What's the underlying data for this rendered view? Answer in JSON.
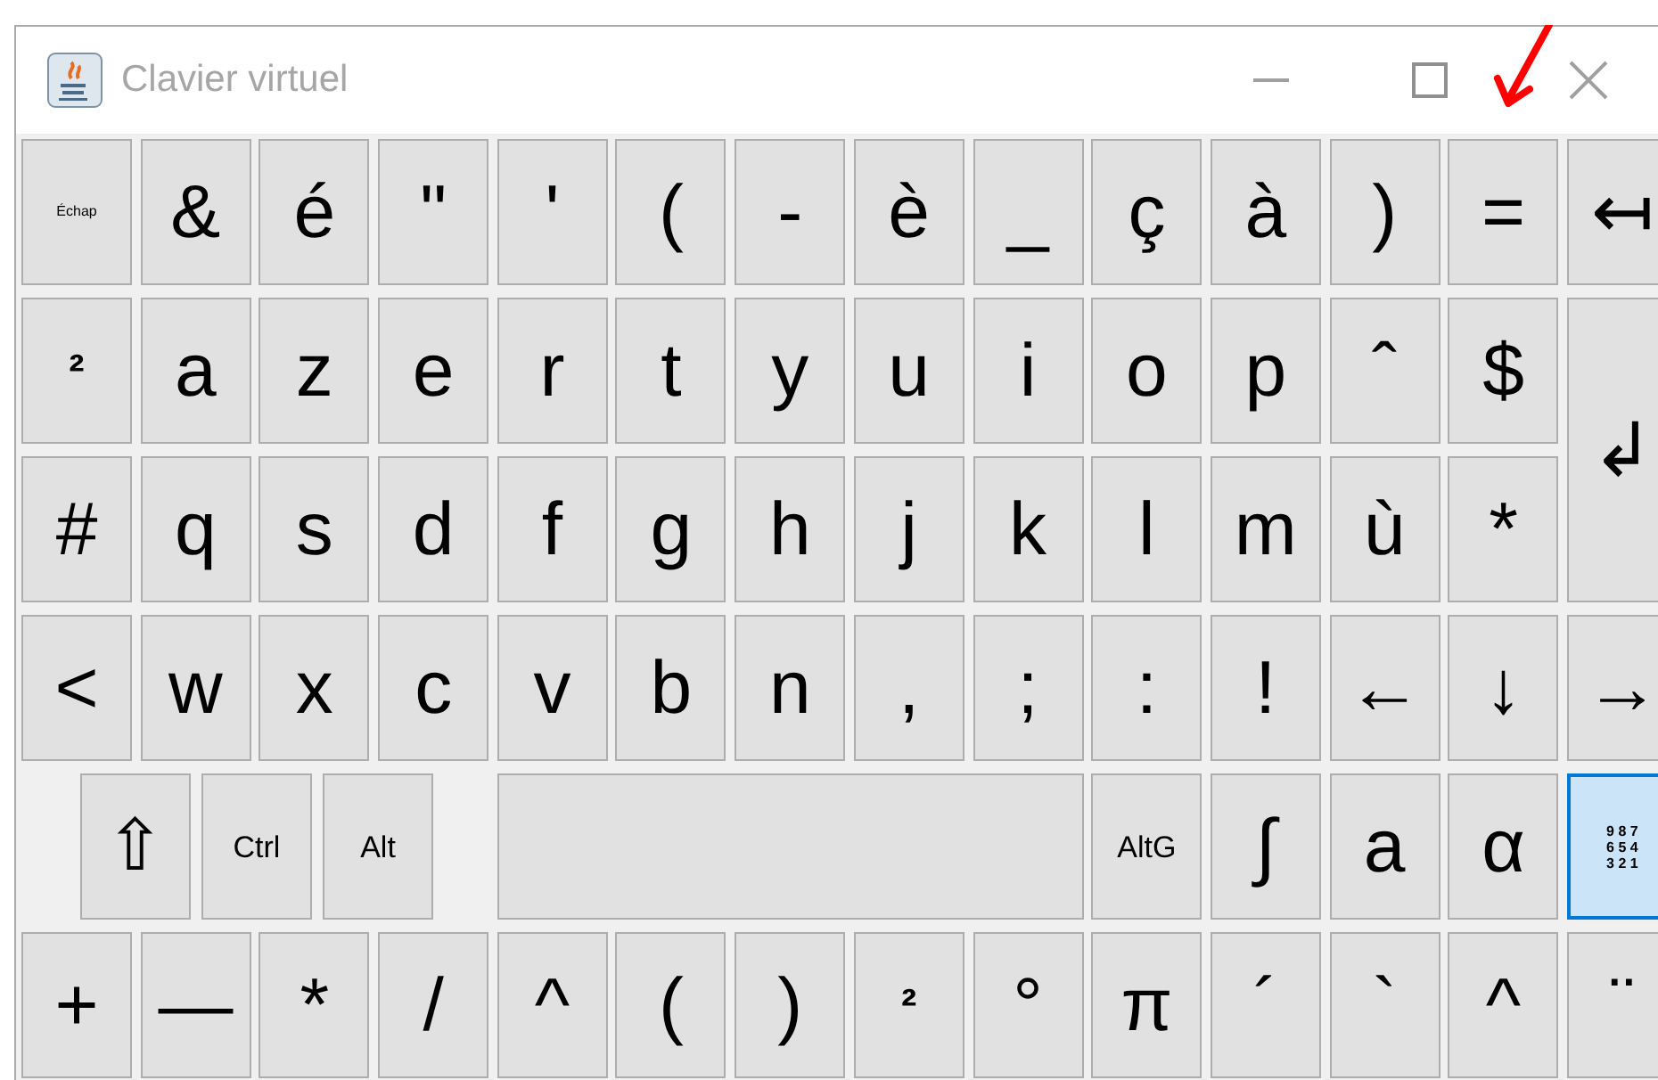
{
  "window": {
    "title": "Clavier virtuel"
  },
  "keyboard": {
    "rows": [
      {
        "kind": "normal",
        "keys": [
          {
            "label": "Échap",
            "kind": "small",
            "pressed": false
          },
          {
            "label": "&",
            "kind": "char",
            "pressed": false
          },
          {
            "label": "é",
            "kind": "char",
            "pressed": false
          },
          {
            "label": "\"",
            "kind": "char",
            "pressed": false
          },
          {
            "label": "'",
            "kind": "char",
            "pressed": false
          },
          {
            "label": "(",
            "kind": "char",
            "pressed": false
          },
          {
            "label": "-",
            "kind": "char",
            "pressed": false
          },
          {
            "label": "è",
            "kind": "char",
            "pressed": false
          },
          {
            "label": "_",
            "kind": "char",
            "pressed": false
          },
          {
            "label": "ç",
            "kind": "char",
            "pressed": false
          },
          {
            "label": "à",
            "kind": "char",
            "pressed": false
          },
          {
            "label": ")",
            "kind": "char",
            "pressed": false
          },
          {
            "label": "=",
            "kind": "char",
            "pressed": false
          },
          {
            "label": "↤",
            "kind": "char",
            "pressed": false
          }
        ]
      },
      {
        "kind": "normal",
        "keys": [
          {
            "label": "²",
            "kind": "bold",
            "pressed": false
          },
          {
            "label": "a",
            "kind": "char",
            "pressed": false
          },
          {
            "label": "z",
            "kind": "char",
            "pressed": false
          },
          {
            "label": "e",
            "kind": "char",
            "pressed": false
          },
          {
            "label": "r",
            "kind": "char",
            "pressed": false
          },
          {
            "label": "t",
            "kind": "char",
            "pressed": false
          },
          {
            "label": "y",
            "kind": "char",
            "pressed": false
          },
          {
            "label": "u",
            "kind": "char",
            "pressed": false
          },
          {
            "label": "i",
            "kind": "char",
            "pressed": false
          },
          {
            "label": "o",
            "kind": "char",
            "pressed": false
          },
          {
            "label": "p",
            "kind": "char",
            "pressed": false
          },
          {
            "label": "ˆ",
            "kind": "char",
            "pressed": false
          },
          {
            "label": "$",
            "kind": "char",
            "pressed": false
          },
          {
            "label": "↲",
            "kind": "enter",
            "pressed": false
          }
        ]
      },
      {
        "kind": "normal",
        "keys": [
          {
            "label": "#",
            "kind": "char",
            "pressed": false
          },
          {
            "label": "q",
            "kind": "char",
            "pressed": false
          },
          {
            "label": "s",
            "kind": "char",
            "pressed": false
          },
          {
            "label": "d",
            "kind": "char",
            "pressed": false
          },
          {
            "label": "f",
            "kind": "char",
            "pressed": false
          },
          {
            "label": "g",
            "kind": "char",
            "pressed": false
          },
          {
            "label": "h",
            "kind": "char",
            "pressed": false
          },
          {
            "label": "j",
            "kind": "char",
            "pressed": false
          },
          {
            "label": "k",
            "kind": "char",
            "pressed": false
          },
          {
            "label": "l",
            "kind": "char",
            "pressed": false
          },
          {
            "label": "m",
            "kind": "char",
            "pressed": false
          },
          {
            "label": "ù",
            "kind": "char",
            "pressed": false
          },
          {
            "label": "*",
            "kind": "char",
            "pressed": false
          }
        ]
      },
      {
        "kind": "normal",
        "keys": [
          {
            "label": "<",
            "kind": "char",
            "pressed": false
          },
          {
            "label": "w",
            "kind": "char",
            "pressed": false
          },
          {
            "label": "x",
            "kind": "char",
            "pressed": false
          },
          {
            "label": "c",
            "kind": "char",
            "pressed": false
          },
          {
            "label": "v",
            "kind": "char",
            "pressed": false
          },
          {
            "label": "b",
            "kind": "char",
            "pressed": false
          },
          {
            "label": "n",
            "kind": "char",
            "pressed": false
          },
          {
            "label": ",",
            "kind": "char",
            "pressed": false
          },
          {
            "label": ";",
            "kind": "char",
            "pressed": false
          },
          {
            "label": ":",
            "kind": "char",
            "pressed": false
          },
          {
            "label": "!",
            "kind": "char",
            "pressed": false
          },
          {
            "label": "←",
            "kind": "char",
            "pressed": false
          },
          {
            "label": "↓",
            "kind": "char",
            "pressed": false
          },
          {
            "label": "→",
            "kind": "char",
            "pressed": false
          }
        ]
      },
      {
        "kind": "modifiers",
        "keys": [
          {
            "label": "⇧",
            "kind": "shift",
            "pressed": false
          },
          {
            "label": "Ctrl",
            "kind": "mod",
            "pressed": false
          },
          {
            "label": "Alt",
            "kind": "mod",
            "pressed": false
          },
          {
            "kind": "space",
            "pressed": false
          },
          {
            "label": "AltG",
            "kind": "mod",
            "pressed": false
          },
          {
            "label": "∫",
            "kind": "char",
            "pressed": false
          },
          {
            "label": "a",
            "kind": "char",
            "pressed": false
          },
          {
            "label": "α",
            "kind": "char",
            "pressed": false
          },
          {
            "lines": [
              "9 8 7",
              "6 5 4",
              "3 2 1"
            ],
            "kind": "numpad",
            "pressed": true
          }
        ]
      },
      {
        "kind": "normal",
        "keys": [
          {
            "label": "+",
            "kind": "char",
            "pressed": false
          },
          {
            "label": "—",
            "kind": "char",
            "pressed": false
          },
          {
            "label": "*",
            "kind": "char",
            "pressed": false
          },
          {
            "label": "/",
            "kind": "char",
            "pressed": false
          },
          {
            "label": "^",
            "kind": "char",
            "pressed": false
          },
          {
            "label": "(",
            "kind": "char",
            "pressed": false
          },
          {
            "label": ")",
            "kind": "char",
            "pressed": false
          },
          {
            "label": "²",
            "kind": "bold",
            "pressed": false
          },
          {
            "label": "°",
            "kind": "char",
            "pressed": false
          },
          {
            "label": "π",
            "kind": "char",
            "pressed": false
          },
          {
            "label": "´",
            "kind": "char",
            "pressed": false
          },
          {
            "label": "`",
            "kind": "char",
            "pressed": false
          },
          {
            "label": "^",
            "kind": "char",
            "pressed": false
          },
          {
            "label": "¨",
            "kind": "char",
            "pressed": false
          }
        ]
      }
    ]
  }
}
